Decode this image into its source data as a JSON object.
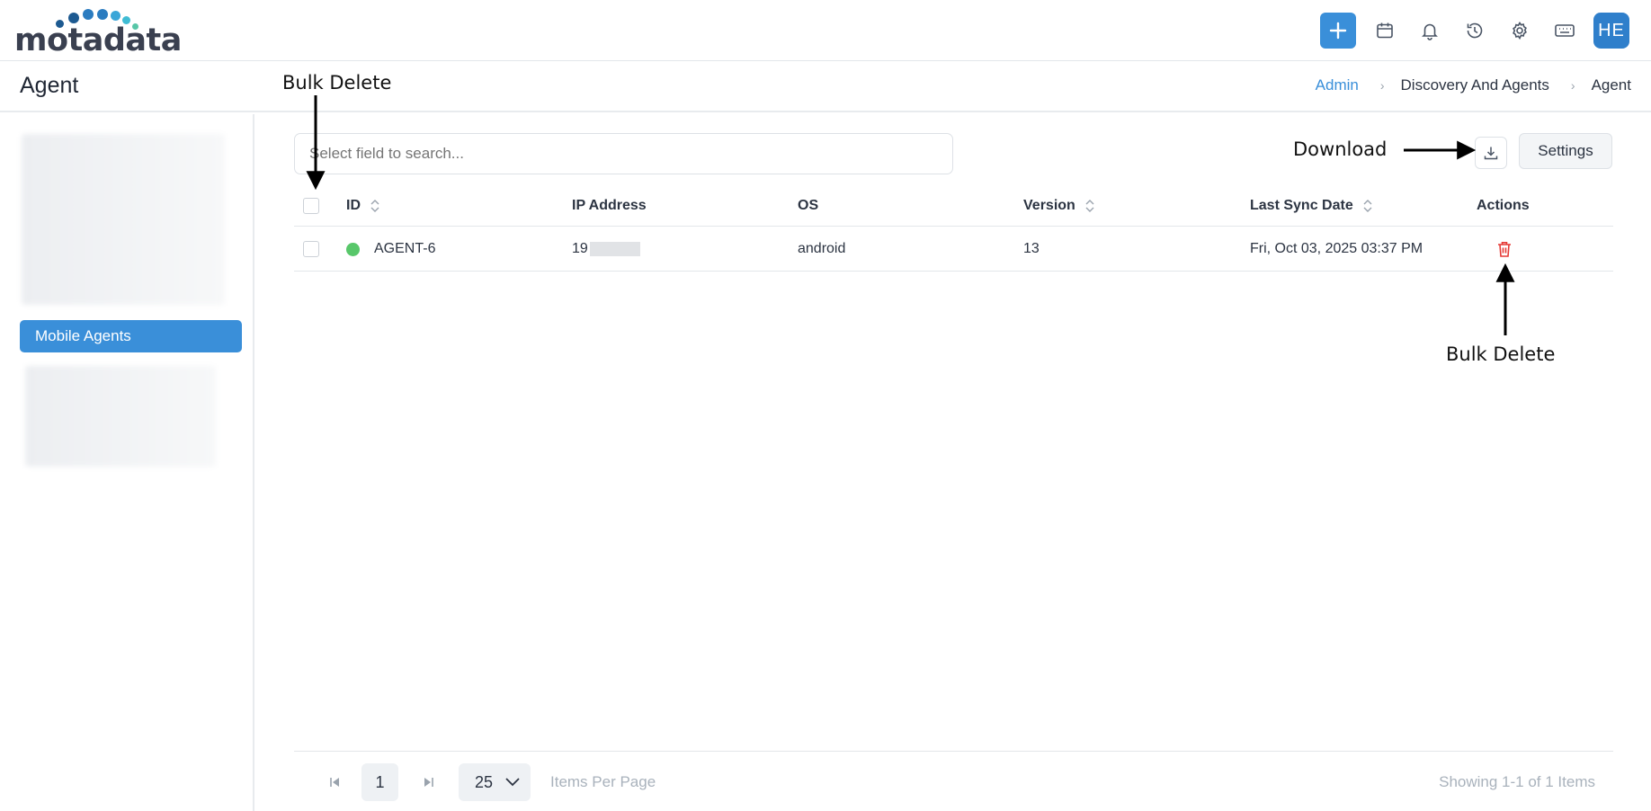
{
  "app": {
    "logo_text": "motadata",
    "user_initials": "HE"
  },
  "header": {
    "title": "Agent",
    "breadcrumb": [
      "Admin",
      "Discovery And Agents",
      "Agent"
    ]
  },
  "sidebar": {
    "active_item": "Mobile Agents"
  },
  "toolbar": {
    "search_placeholder": "Select field to search...",
    "settings_label": "Settings"
  },
  "table": {
    "columns": [
      "ID",
      "IP Address",
      "OS",
      "Version",
      "Last Sync Date",
      "Actions"
    ],
    "rows": [
      {
        "id": "AGENT-6",
        "ip": "19",
        "os": "android",
        "version": "13",
        "last_sync": "Fri, Oct 03, 2025 03:37 PM",
        "status": "online"
      }
    ]
  },
  "pagination": {
    "current_page": "1",
    "per_page": "25",
    "per_page_label": "Items Per Page",
    "showing": "Showing 1-1 of 1 Items"
  },
  "annotations": {
    "bulk_delete_top": "Bulk Delete",
    "download": "Download",
    "bulk_delete_bottom": "Bulk Delete"
  },
  "colors": {
    "accent": "#3a8fd9",
    "status_online": "#58c76a",
    "delete": "#e53935"
  }
}
